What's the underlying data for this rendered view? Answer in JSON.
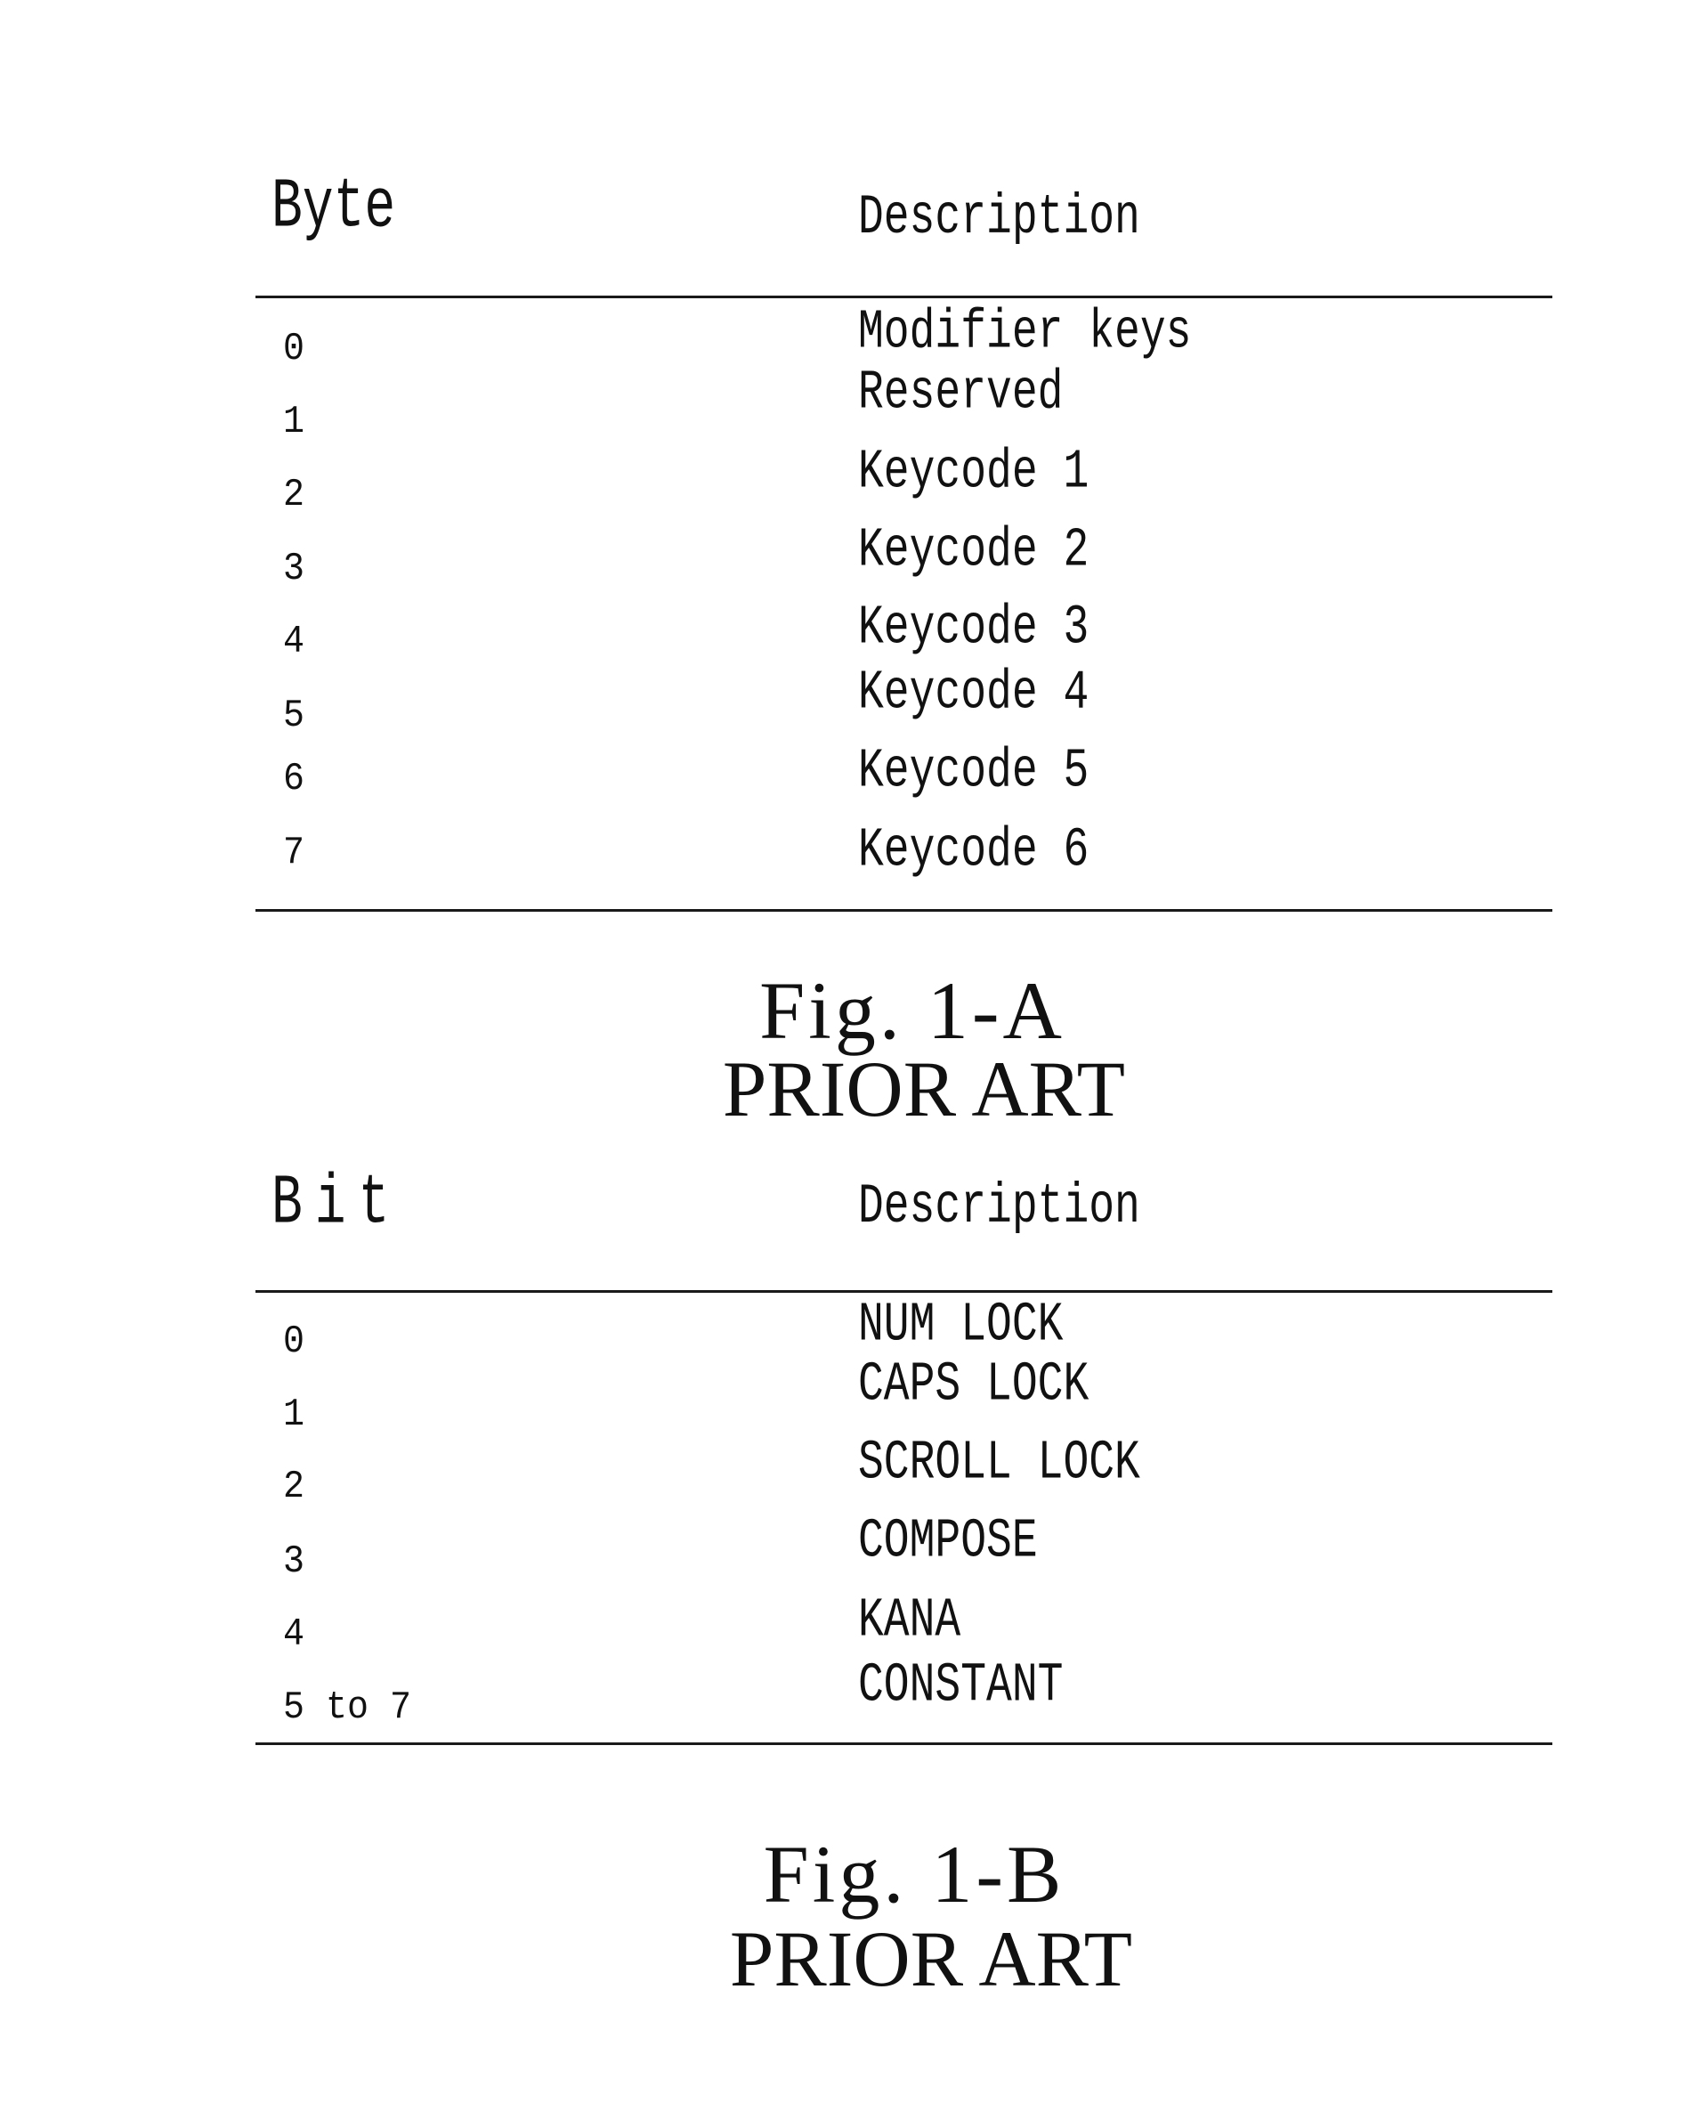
{
  "figure_a": {
    "table": {
      "headers": [
        "Byte",
        "Description"
      ],
      "rows": [
        {
          "key": "0",
          "description": "Modifier keys"
        },
        {
          "key": "1",
          "description": "Reserved"
        },
        {
          "key": "2",
          "description": "Keycode 1"
        },
        {
          "key": "3",
          "description": "Keycode 2"
        },
        {
          "key": "4",
          "description": "Keycode 3"
        },
        {
          "key": "5",
          "description": "Keycode 4"
        },
        {
          "key": "6",
          "description": "Keycode 5"
        },
        {
          "key": "7",
          "description": "Keycode 6"
        }
      ]
    },
    "caption": "Fig. 1-A",
    "subcaption": "PRIOR ART"
  },
  "figure_b": {
    "table": {
      "headers": [
        "Bit",
        "Description"
      ],
      "rows": [
        {
          "key": "0",
          "description": "NUM LOCK"
        },
        {
          "key": "1",
          "description": "CAPS LOCK"
        },
        {
          "key": "2",
          "description": "SCROLL LOCK"
        },
        {
          "key": "3",
          "description": "COMPOSE"
        },
        {
          "key": "4",
          "description": "KANA"
        },
        {
          "key": "5 to 7",
          "description": "CONSTANT"
        }
      ]
    },
    "caption": "Fig. 1-B",
    "subcaption": "PRIOR ART"
  }
}
